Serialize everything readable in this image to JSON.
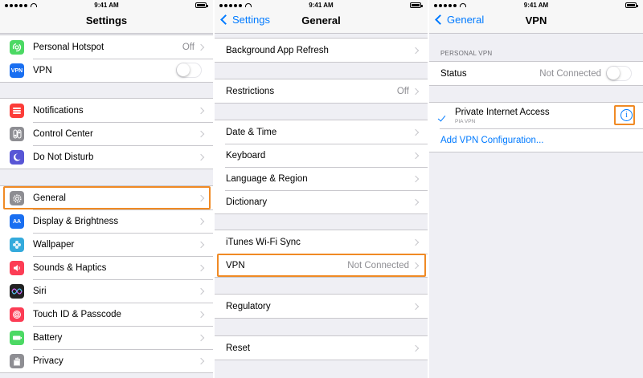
{
  "status_time": "9:41 AM",
  "settings": {
    "title": "Settings",
    "group1": [
      {
        "label": "Personal Hotspot",
        "value": "Off",
        "icon": "hotspot-icon",
        "color": "#4cd964"
      },
      {
        "label": "VPN",
        "value": "",
        "icon": "vpn-icon",
        "icon_text": "VPN",
        "color": "#1a6ff1"
      }
    ],
    "group2": [
      {
        "label": "Notifications",
        "icon": "notifications-icon",
        "color": "#fc3d39"
      },
      {
        "label": "Control Center",
        "icon": "control-center-icon",
        "color": "#8e8e93"
      },
      {
        "label": "Do Not Disturb",
        "icon": "moon-icon",
        "color": "#5856d6"
      }
    ],
    "group3": [
      {
        "label": "General",
        "icon": "gear-icon",
        "color": "#8e8e93"
      },
      {
        "label": "Display & Brightness",
        "icon": "display-icon",
        "icon_text": "AA",
        "color": "#1a6ff1"
      },
      {
        "label": "Wallpaper",
        "icon": "wallpaper-icon",
        "color": "#34aadc"
      },
      {
        "label": "Sounds & Haptics",
        "icon": "speaker-icon",
        "color": "#fc3d55"
      },
      {
        "label": "Siri",
        "icon": "siri-icon",
        "color": "#222222"
      },
      {
        "label": "Touch ID & Passcode",
        "icon": "fingerprint-icon",
        "color": "#fc3d55"
      },
      {
        "label": "Battery",
        "icon": "battery-icon",
        "color": "#4cd964"
      },
      {
        "label": "Privacy",
        "icon": "hand-icon",
        "color": "#8e8e93"
      }
    ]
  },
  "general": {
    "back": "Settings",
    "title": "General",
    "groups": [
      [
        {
          "label": "Background App Refresh",
          "value": ""
        }
      ],
      [
        {
          "label": "Restrictions",
          "value": "Off"
        }
      ],
      [
        {
          "label": "Date & Time",
          "value": ""
        },
        {
          "label": "Keyboard",
          "value": ""
        },
        {
          "label": "Language & Region",
          "value": ""
        },
        {
          "label": "Dictionary",
          "value": ""
        }
      ],
      [
        {
          "label": "iTunes Wi-Fi Sync",
          "value": ""
        },
        {
          "label": "VPN",
          "value": "Not Connected"
        }
      ],
      [
        {
          "label": "Regulatory",
          "value": ""
        }
      ],
      [
        {
          "label": "Reset",
          "value": ""
        }
      ]
    ]
  },
  "vpn": {
    "back": "General",
    "title": "VPN",
    "section_header": "PERSONAL VPN",
    "status_label": "Status",
    "status_value": "Not Connected",
    "config_name": "Private Internet Access",
    "config_sub": "PIA VPN",
    "info_glyph": "i",
    "add_label": "Add VPN Configuration..."
  },
  "highlight_color": "#f08a24"
}
